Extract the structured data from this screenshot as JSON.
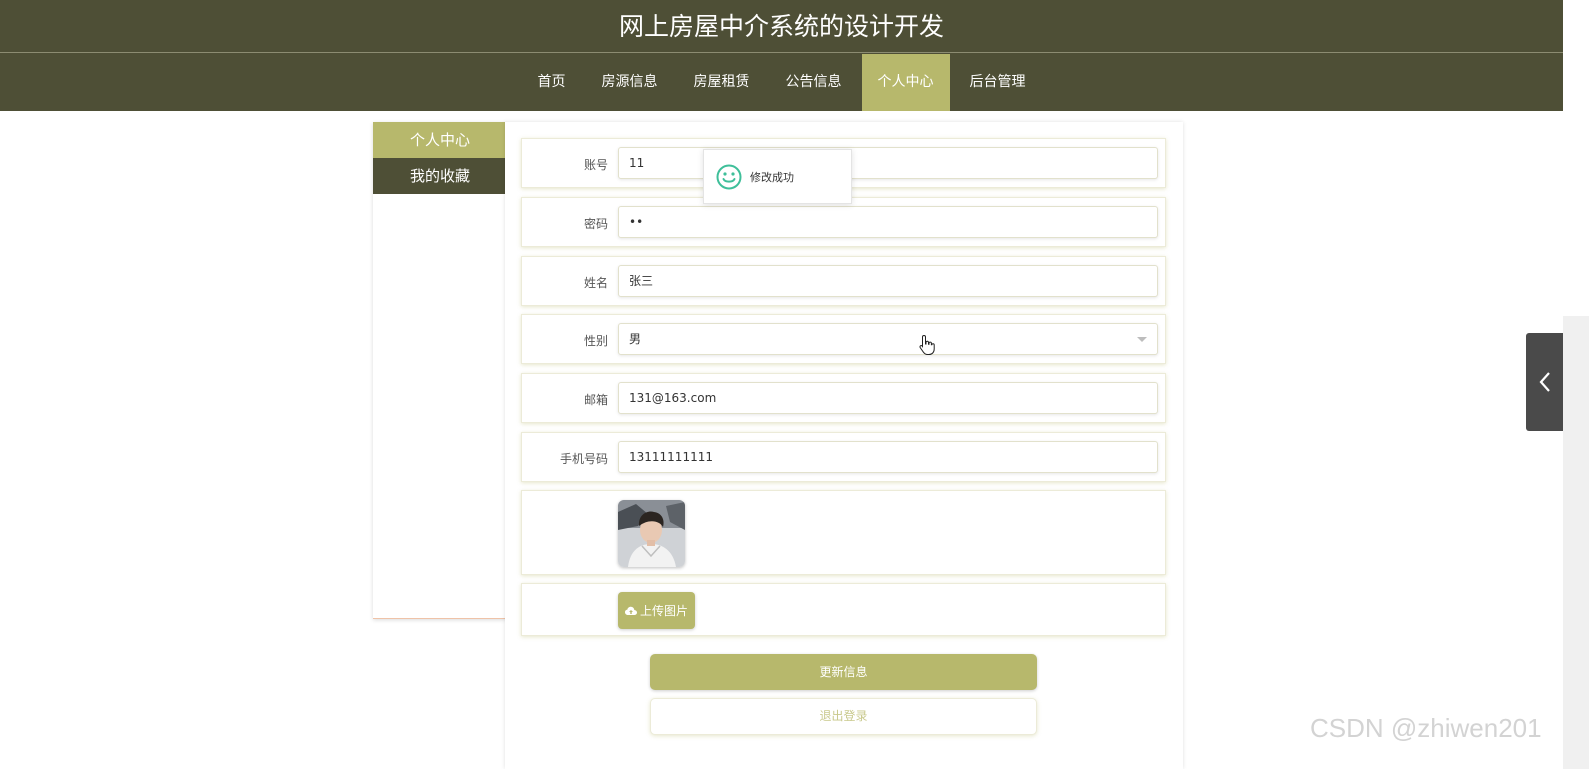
{
  "site": {
    "title": "网上房屋中介系统的设计开发"
  },
  "nav": {
    "items": [
      {
        "label": "首页"
      },
      {
        "label": "房源信息"
      },
      {
        "label": "房屋租赁"
      },
      {
        "label": "公告信息"
      },
      {
        "label": "个人中心",
        "active": true
      },
      {
        "label": "后台管理"
      }
    ]
  },
  "sidebar": {
    "items": [
      {
        "label": "个人中心",
        "active": true
      },
      {
        "label": "我的收藏"
      }
    ]
  },
  "form": {
    "account": {
      "label": "账号",
      "value": "11"
    },
    "password": {
      "label": "密码",
      "value": "••"
    },
    "name": {
      "label": "姓名",
      "value": "张三"
    },
    "gender": {
      "label": "性别",
      "value": "男"
    },
    "email": {
      "label": "邮箱",
      "value": "131@163.com"
    },
    "phone": {
      "label": "手机号码",
      "value": "13111111111"
    },
    "upload_label": "上传图片",
    "update_label": "更新信息",
    "logout_label": "退出登录"
  },
  "toast": {
    "message": "修改成功",
    "icon": "smile-icon"
  },
  "watermark": {
    "text": "CSDN @zhiwen201"
  },
  "colors": {
    "header_bg": "#4e4f36",
    "accent": "#b7b86c",
    "toast_icon": "#3fbf9a"
  }
}
